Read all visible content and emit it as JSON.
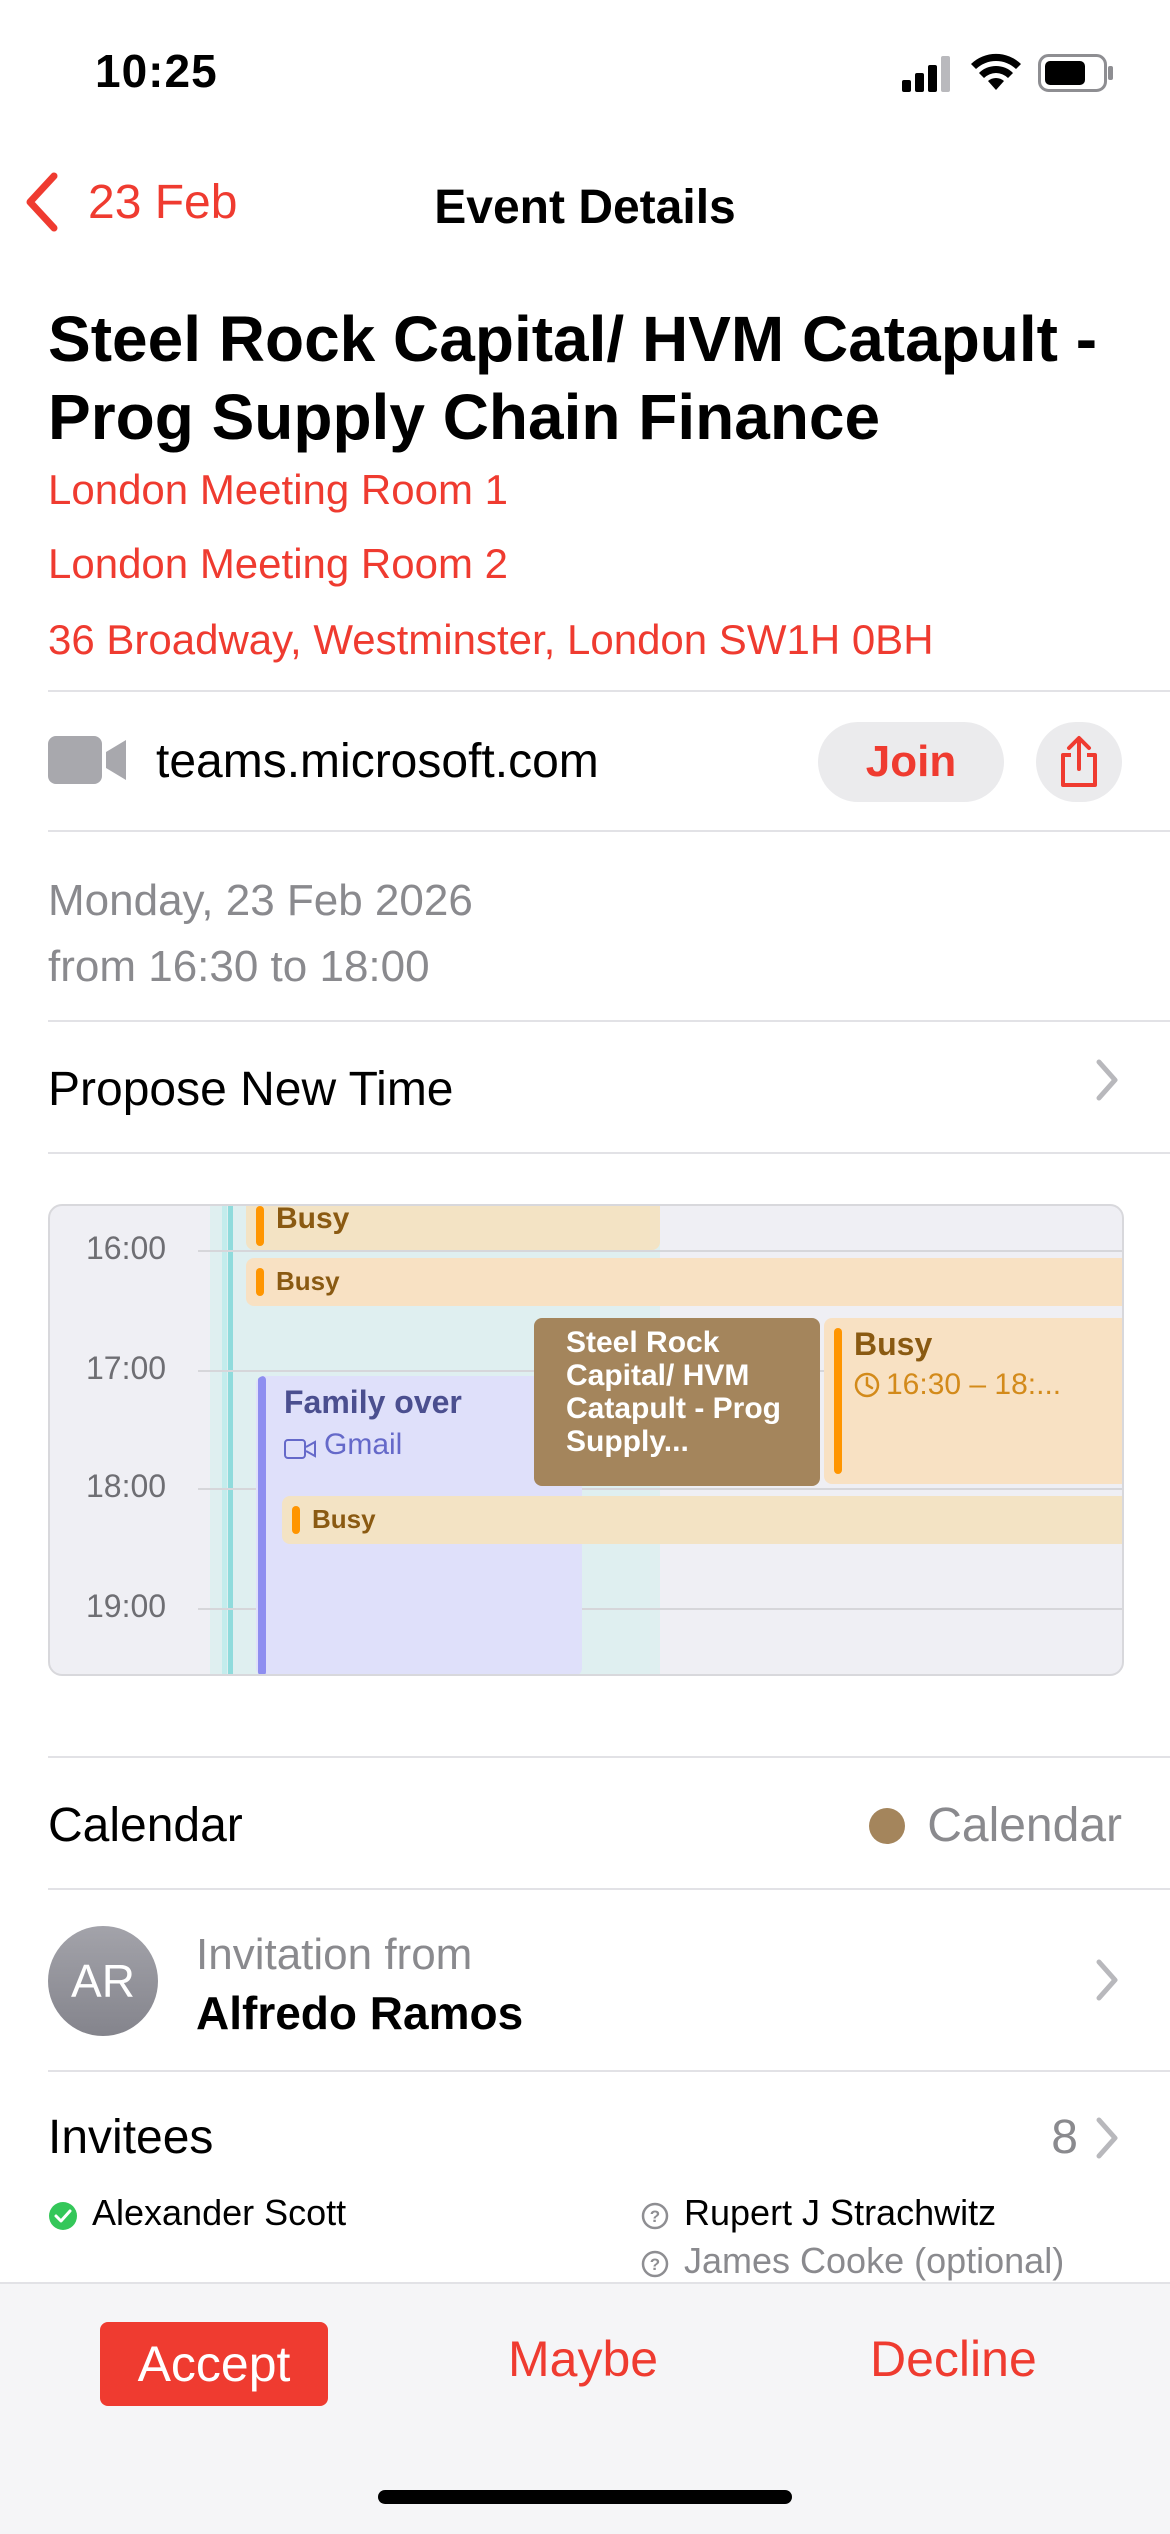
{
  "status_bar": {
    "time": "10:25"
  },
  "nav": {
    "back_label": "23 Feb",
    "title": "Event Details"
  },
  "event": {
    "title": "Steel Rock Capital/ HVM Catapult - Prog Supply Chain Finance",
    "locations": [
      "London Meeting Room 1",
      "London Meeting Room 2",
      "36 Broadway,  Westminster, London SW1H 0BH"
    ],
    "meeting_link": "teams.microsoft.com",
    "join_label": "Join",
    "date_line": "Monday, 23 Feb 2026",
    "time_line": "from 16:30 to 18:00",
    "propose_label": "Propose New Time"
  },
  "timeline": {
    "hours": [
      "16:00",
      "17:00",
      "18:00",
      "19:00"
    ],
    "events": {
      "busy_top": "Busy",
      "busy_row": "Busy",
      "this_event": "Steel Rock Capital/ HVM Catapult - Prog Supply...",
      "busy_right_title": "Busy",
      "busy_right_time": "16:30 – 18:...",
      "family_title": "Family over",
      "family_source": "Gmail",
      "busy_bottom": "Busy"
    }
  },
  "calendar": {
    "label": "Calendar",
    "value": "Calendar",
    "color": "#a4855c"
  },
  "invitation": {
    "initials": "AR",
    "from_label": "Invitation from",
    "organizer": "Alfredo Ramos"
  },
  "invitees": {
    "label": "Invitees",
    "count": "8",
    "people": [
      {
        "name": "Alexander Scott",
        "status": "accepted"
      },
      {
        "name": "Rupert J Strachwitz",
        "status": "unknown"
      },
      {
        "name": "James Cooke (optional)",
        "status": "unknown"
      }
    ]
  },
  "actions": {
    "accept": "Accept",
    "maybe": "Maybe",
    "decline": "Decline"
  },
  "colors": {
    "accent": "#ef3b30",
    "busy": "#ff9500",
    "event": "#a4855c",
    "family": "#8e8ef0"
  }
}
